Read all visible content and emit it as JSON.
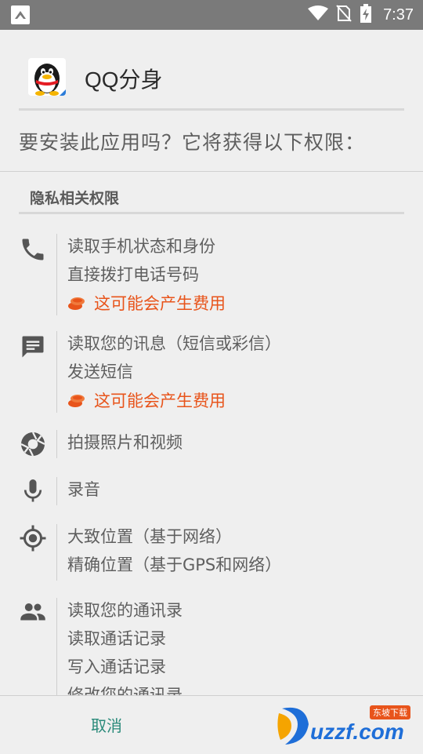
{
  "status_bar": {
    "time": "7:37",
    "icons": [
      "notification-icon",
      "wifi-icon",
      "no-sim-icon",
      "battery-charging-icon"
    ]
  },
  "header": {
    "app_name": "QQ分身",
    "app_icon": "qq-penguin-icon"
  },
  "question": "要安装此应用吗？它将获得以下权限：",
  "section": {
    "title": "隐私相关权限"
  },
  "permissions": [
    {
      "icon": "phone-icon",
      "lines": [
        "读取手机状态和身份",
        "直接拨打电话号码"
      ],
      "cost": "这可能会产生费用"
    },
    {
      "icon": "message-icon",
      "lines": [
        "读取您的讯息（短信或彩信）",
        "发送短信"
      ],
      "cost": "这可能会产生费用"
    },
    {
      "icon": "camera-icon",
      "lines": [
        "拍摄照片和视频"
      ]
    },
    {
      "icon": "microphone-icon",
      "lines": [
        "录音"
      ]
    },
    {
      "icon": "location-icon",
      "lines": [
        "大致位置（基于网络）",
        "精确位置（基于GPS和网络）"
      ]
    },
    {
      "icon": "contacts-icon",
      "lines": [
        "读取您的通讯录",
        "读取通话记录",
        "写入通话记录",
        "修改您的通讯录"
      ]
    }
  ],
  "bottom": {
    "cancel_label": "取消",
    "watermark_text": "uzzf.com",
    "watermark_tag": "东坡下载"
  },
  "colors": {
    "status_bar": "#7a7a7a",
    "background": "#efefef",
    "cost_warning": "#e8541b",
    "cancel_button": "#2a8a7a"
  }
}
